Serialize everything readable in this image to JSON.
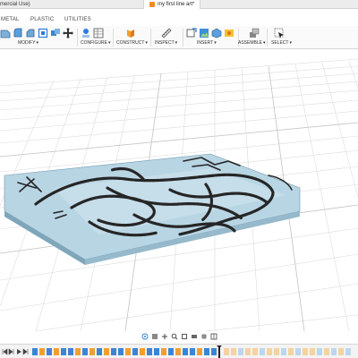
{
  "window": {
    "title_fragment": "mercial Use)",
    "document_tab": "my first line art*"
  },
  "ribbon": {
    "tabs": [
      "METAL",
      "PLASTIC",
      "UTILITIES"
    ]
  },
  "toolbar": {
    "groups": [
      {
        "label": "MODIFY"
      },
      {
        "label": "CONFIGURE"
      },
      {
        "label": "CONSTRUCT"
      },
      {
        "label": "INSPECT"
      },
      {
        "label": "INSERT"
      },
      {
        "label": "ASSEMBLE"
      },
      {
        "label": "SELECT"
      }
    ]
  },
  "colors": {
    "accent_blue": "#2b7de0",
    "plate_top": "#b9d7e6",
    "plate_side": "#8fb3c6",
    "relief": "#2a2a2a"
  }
}
